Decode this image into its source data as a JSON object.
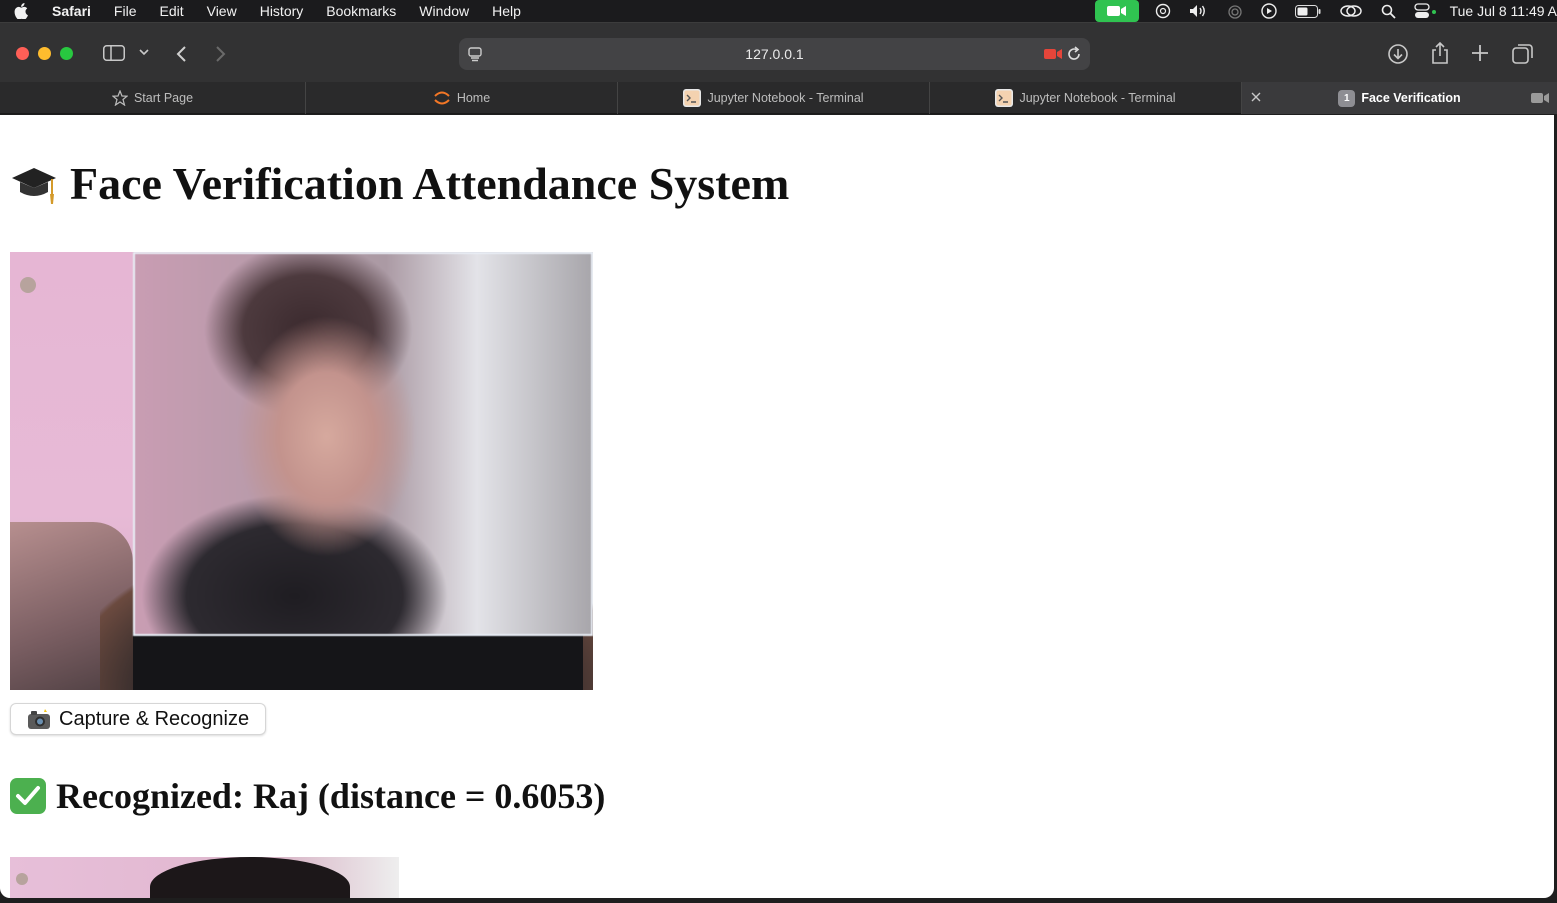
{
  "menubar": {
    "app_name": "Safari",
    "items": [
      "File",
      "Edit",
      "View",
      "History",
      "Bookmarks",
      "Window",
      "Help"
    ],
    "clock": "Tue Jul 8  11:49 A"
  },
  "toolbar": {
    "url": "127.0.0.1"
  },
  "tabs": [
    {
      "label": "Start Page"
    },
    {
      "label": "Home"
    },
    {
      "label": "Jupyter Notebook - Terminal"
    },
    {
      "label": "Jupyter Notebook - Terminal"
    },
    {
      "label": "Face Verification",
      "badge": "1"
    }
  ],
  "page": {
    "title": "Face Verification Attendance System",
    "capture_label": "Capture & Recognize",
    "result_text": "Recognized: Raj (distance = 0.6053)"
  },
  "colors": {
    "accent_green": "#4cb04f",
    "facetime_green": "#30c351",
    "recording_red": "#e5453a"
  }
}
